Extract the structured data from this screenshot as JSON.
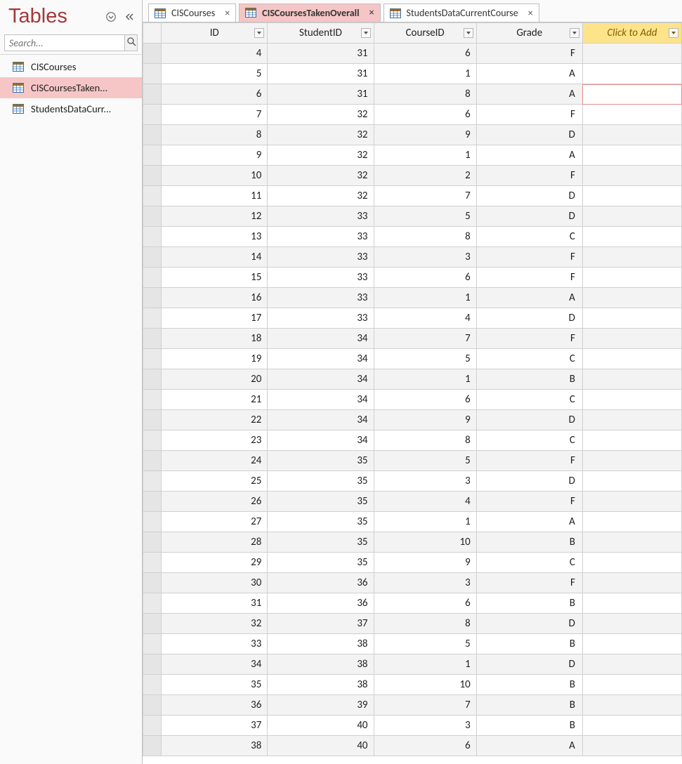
{
  "nav": {
    "title": "Tables",
    "search_placeholder": "Search...",
    "items": [
      {
        "label": "CISCourses"
      },
      {
        "label": "CISCoursesTaken..."
      },
      {
        "label": "StudentsDataCurr..."
      }
    ],
    "active_index": 1
  },
  "tabs": [
    {
      "label": "CISCourses",
      "active": false
    },
    {
      "label": "CISCoursesTakenOverall",
      "active": true
    },
    {
      "label": "StudentsDataCurrentCourse",
      "active": false
    }
  ],
  "datasheet": {
    "columns": [
      "ID",
      "StudentID",
      "CourseID",
      "Grade"
    ],
    "add_column_label": "Click to Add",
    "active_row_id": 6,
    "rows": [
      {
        "ID": 4,
        "StudentID": 31,
        "CourseID": 6,
        "Grade": "F"
      },
      {
        "ID": 5,
        "StudentID": 31,
        "CourseID": 1,
        "Grade": "A"
      },
      {
        "ID": 6,
        "StudentID": 31,
        "CourseID": 8,
        "Grade": "A"
      },
      {
        "ID": 7,
        "StudentID": 32,
        "CourseID": 6,
        "Grade": "F"
      },
      {
        "ID": 8,
        "StudentID": 32,
        "CourseID": 9,
        "Grade": "D"
      },
      {
        "ID": 9,
        "StudentID": 32,
        "CourseID": 1,
        "Grade": "A"
      },
      {
        "ID": 10,
        "StudentID": 32,
        "CourseID": 2,
        "Grade": "F"
      },
      {
        "ID": 11,
        "StudentID": 32,
        "CourseID": 7,
        "Grade": "D"
      },
      {
        "ID": 12,
        "StudentID": 33,
        "CourseID": 5,
        "Grade": "D"
      },
      {
        "ID": 13,
        "StudentID": 33,
        "CourseID": 8,
        "Grade": "C"
      },
      {
        "ID": 14,
        "StudentID": 33,
        "CourseID": 3,
        "Grade": "F"
      },
      {
        "ID": 15,
        "StudentID": 33,
        "CourseID": 6,
        "Grade": "F"
      },
      {
        "ID": 16,
        "StudentID": 33,
        "CourseID": 1,
        "Grade": "A"
      },
      {
        "ID": 17,
        "StudentID": 33,
        "CourseID": 4,
        "Grade": "D"
      },
      {
        "ID": 18,
        "StudentID": 34,
        "CourseID": 7,
        "Grade": "F"
      },
      {
        "ID": 19,
        "StudentID": 34,
        "CourseID": 5,
        "Grade": "C"
      },
      {
        "ID": 20,
        "StudentID": 34,
        "CourseID": 1,
        "Grade": "B"
      },
      {
        "ID": 21,
        "StudentID": 34,
        "CourseID": 6,
        "Grade": "C"
      },
      {
        "ID": 22,
        "StudentID": 34,
        "CourseID": 9,
        "Grade": "D"
      },
      {
        "ID": 23,
        "StudentID": 34,
        "CourseID": 8,
        "Grade": "C"
      },
      {
        "ID": 24,
        "StudentID": 35,
        "CourseID": 5,
        "Grade": "F"
      },
      {
        "ID": 25,
        "StudentID": 35,
        "CourseID": 3,
        "Grade": "D"
      },
      {
        "ID": 26,
        "StudentID": 35,
        "CourseID": 4,
        "Grade": "F"
      },
      {
        "ID": 27,
        "StudentID": 35,
        "CourseID": 1,
        "Grade": "A"
      },
      {
        "ID": 28,
        "StudentID": 35,
        "CourseID": 10,
        "Grade": "B"
      },
      {
        "ID": 29,
        "StudentID": 35,
        "CourseID": 9,
        "Grade": "C"
      },
      {
        "ID": 30,
        "StudentID": 36,
        "CourseID": 3,
        "Grade": "F"
      },
      {
        "ID": 31,
        "StudentID": 36,
        "CourseID": 6,
        "Grade": "B"
      },
      {
        "ID": 32,
        "StudentID": 37,
        "CourseID": 8,
        "Grade": "D"
      },
      {
        "ID": 33,
        "StudentID": 38,
        "CourseID": 5,
        "Grade": "B"
      },
      {
        "ID": 34,
        "StudentID": 38,
        "CourseID": 1,
        "Grade": "D"
      },
      {
        "ID": 35,
        "StudentID": 38,
        "CourseID": 10,
        "Grade": "B"
      },
      {
        "ID": 36,
        "StudentID": 39,
        "CourseID": 7,
        "Grade": "B"
      },
      {
        "ID": 37,
        "StudentID": 40,
        "CourseID": 3,
        "Grade": "B"
      },
      {
        "ID": 38,
        "StudentID": 40,
        "CourseID": 6,
        "Grade": "A"
      }
    ]
  }
}
